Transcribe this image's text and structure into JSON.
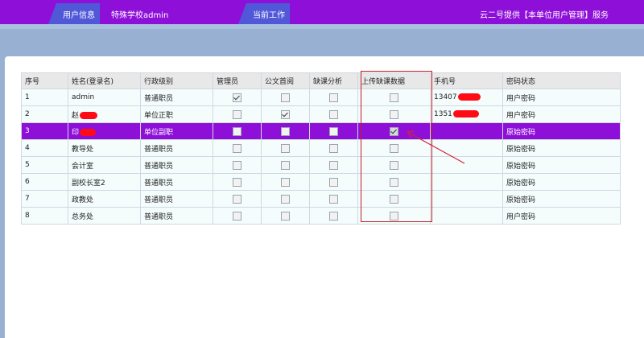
{
  "header": {
    "tab_user_info": "用户信息",
    "user_name": "特殊学校admin",
    "tab_current_work": "当前工作",
    "service_text": "云二号提供【本单位用户管理】服务"
  },
  "table": {
    "columns": [
      "序号",
      "姓名(登录名)",
      "行政级别",
      "管理员",
      "公文首阅",
      "缺课分析",
      "上传缺课数据",
      "手机号",
      "密码状态"
    ],
    "rows": [
      {
        "no": "1",
        "name": "admin",
        "level": "普通职员",
        "admin": true,
        "doc": false,
        "absence": false,
        "upload": false,
        "phone": "13407",
        "pwd": "用户密码"
      },
      {
        "no": "2",
        "name": "赵",
        "level": "单位正职",
        "admin": false,
        "doc": true,
        "absence": false,
        "upload": false,
        "phone": "1351",
        "pwd": "用户密码"
      },
      {
        "no": "3",
        "name": "印",
        "level": "单位副职",
        "admin": false,
        "doc": false,
        "absence": false,
        "upload": true,
        "phone": "",
        "pwd": "原始密码"
      },
      {
        "no": "4",
        "name": "教导处",
        "level": "普通职员",
        "admin": false,
        "doc": false,
        "absence": false,
        "upload": false,
        "phone": "",
        "pwd": "原始密码"
      },
      {
        "no": "5",
        "name": "会计室",
        "level": "普通职员",
        "admin": false,
        "doc": false,
        "absence": false,
        "upload": false,
        "phone": "",
        "pwd": "原始密码"
      },
      {
        "no": "6",
        "name": "副校长室2",
        "level": "普通职员",
        "admin": false,
        "doc": false,
        "absence": false,
        "upload": false,
        "phone": "",
        "pwd": "原始密码"
      },
      {
        "no": "7",
        "name": "政教处",
        "level": "普通职员",
        "admin": false,
        "doc": false,
        "absence": false,
        "upload": false,
        "phone": "",
        "pwd": "原始密码"
      },
      {
        "no": "8",
        "name": "总务处",
        "level": "普通职员",
        "admin": false,
        "doc": false,
        "absence": false,
        "upload": false,
        "phone": "",
        "pwd": "用户密码"
      }
    ]
  },
  "colors": {
    "topbar": "#8e0fd8",
    "tab": "#5058d8",
    "selected_row": "#8e0fd8",
    "highlight": "#c31a24",
    "redaction": "#ff0b16"
  }
}
